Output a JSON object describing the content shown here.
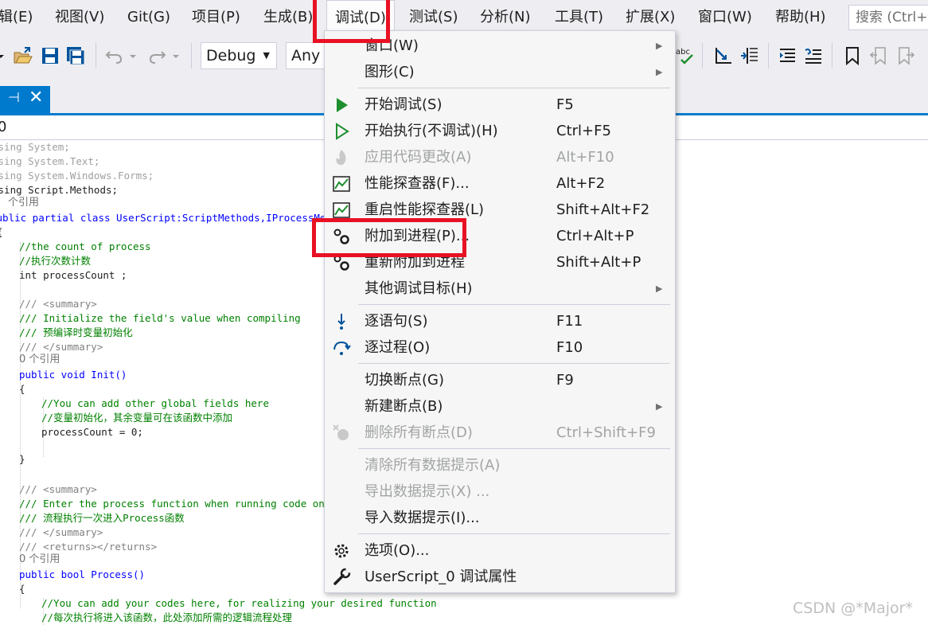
{
  "menubar": {
    "items": [
      "辑(E)",
      "视图(V)",
      "Git(G)",
      "项目(P)",
      "生成(B)",
      "调试(D)",
      "测试(S)",
      "分析(N)",
      "工具(T)",
      "扩展(X)",
      "窗口(W)",
      "帮助(H)"
    ],
    "search_placeholder": "搜索 (Ctrl+"
  },
  "toolbar": {
    "configuration": "Debug",
    "platform": "Any C"
  },
  "navbar": {
    "text": "0"
  },
  "code": {
    "lines": [
      "using System;",
      "using System.Text;",
      "using System.Windows.Forms;",
      "using Script.Methods;",
      "个引用",
      "public partial class UserScript:ScriptMethods,IProcessMe",
      "{",
      "//the count of process",
      "//执行次数计数",
      "int processCount ;",
      "/// <summary>",
      "/// Initialize the field's value when compiling",
      "/// 预编译时变量初始化",
      "/// </summary>",
      "0 个引用",
      "public void Init()",
      "{",
      "//You can add other global fields here",
      "//变量初始化，其余变量可在该函数中添加",
      "processCount = 0;",
      "}",
      "/// <summary>",
      "/// Enter the process function when running code once",
      "/// 流程执行一次进入Process函数",
      "/// </summary>",
      "/// <returns></returns>",
      "0 个引用",
      "public bool Process()",
      "{",
      "//You can add your codes here, for realizing your desired function",
      "//每次执行将进入该函数，此处添加所需的逻辑流程处理"
    ]
  },
  "debug_menu": {
    "items": [
      {
        "label": "窗口(W)",
        "shortcut": "",
        "submenu": true,
        "disabled": false
      },
      {
        "label": "图形(C)",
        "shortcut": "",
        "submenu": true,
        "disabled": false
      },
      {
        "label": "开始调试(S)",
        "shortcut": "F5",
        "submenu": false,
        "disabled": false
      },
      {
        "label": "开始执行(不调试)(H)",
        "shortcut": "Ctrl+F5",
        "submenu": false,
        "disabled": false
      },
      {
        "label": "应用代码更改(A)",
        "shortcut": "Alt+F10",
        "submenu": false,
        "disabled": true
      },
      {
        "label": "性能探查器(F)...",
        "shortcut": "Alt+F2",
        "submenu": false,
        "disabled": false
      },
      {
        "label": "重启性能探查器(L)",
        "shortcut": "Shift+Alt+F2",
        "submenu": false,
        "disabled": false
      },
      {
        "label": "附加到进程(P)...",
        "shortcut": "Ctrl+Alt+P",
        "submenu": false,
        "disabled": false
      },
      {
        "label": "重新附加到进程",
        "shortcut": "Shift+Alt+P",
        "submenu": false,
        "disabled": false
      },
      {
        "label": "其他调试目标(H)",
        "shortcut": "",
        "submenu": true,
        "disabled": false
      },
      {
        "label": "逐语句(S)",
        "shortcut": "F11",
        "submenu": false,
        "disabled": false
      },
      {
        "label": "逐过程(O)",
        "shortcut": "F10",
        "submenu": false,
        "disabled": false
      },
      {
        "label": "切换断点(G)",
        "shortcut": "F9",
        "submenu": false,
        "disabled": false
      },
      {
        "label": "新建断点(B)",
        "shortcut": "",
        "submenu": true,
        "disabled": false
      },
      {
        "label": "删除所有断点(D)",
        "shortcut": "Ctrl+Shift+F9",
        "submenu": false,
        "disabled": true
      },
      {
        "label": "清除所有数据提示(A)",
        "shortcut": "",
        "submenu": false,
        "disabled": true
      },
      {
        "label": "导出数据提示(X) ...",
        "shortcut": "",
        "submenu": false,
        "disabled": true
      },
      {
        "label": "导入数据提示(I)...",
        "shortcut": "",
        "submenu": false,
        "disabled": false
      },
      {
        "label": "选项(O)...",
        "shortcut": "",
        "submenu": false,
        "disabled": false
      },
      {
        "label": "UserScript_0 调试属性",
        "shortcut": "",
        "submenu": false,
        "disabled": false
      }
    ]
  },
  "watermark": "CSDN @*Major*",
  "colors": {
    "highlight_red": "#e81123",
    "vs_blue": "#007acc",
    "play_green": "#1e8f2e"
  }
}
